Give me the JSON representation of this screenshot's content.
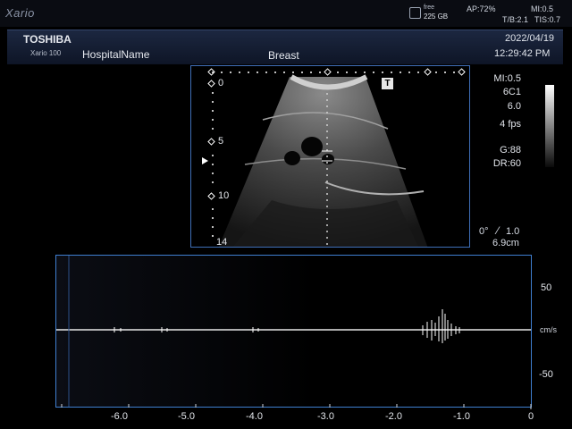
{
  "system": {
    "brand": "Xario",
    "storage_free_label": "free",
    "storage_free_value": "225 GB",
    "ap": "AP:72%",
    "mi": "MI:0.5",
    "tib": "T/B:2.1",
    "tis": "TIS:0.7"
  },
  "header": {
    "manufacturer": "TOSHIBA",
    "model": "Xario 100",
    "hospital": "HospitalName",
    "exam": "Breast",
    "date": "2022/04/19",
    "time": "12:29:42 PM"
  },
  "bmode": {
    "depth_marks": [
      "0",
      "5",
      "10",
      "14"
    ],
    "orientation_mark": "T"
  },
  "params": {
    "mi": "MI:0.5",
    "probe": "6C1",
    "freq": "6.0",
    "fps": "4 fps",
    "gain": "G:88",
    "dr": "DR:60",
    "angle": "0°",
    "angle_corr": "1.0",
    "depth_cm": "6.9cm"
  },
  "doppler": {
    "velocity_labels": [
      "50",
      "cm/s",
      "-50"
    ],
    "time_labels": [
      "-6.0",
      "-5.0",
      "-4.0",
      "-3.0",
      "-2.0",
      "-1.0",
      "0"
    ]
  },
  "colors": {
    "frame": "#3f7fd0",
    "header": "#1c2740"
  }
}
